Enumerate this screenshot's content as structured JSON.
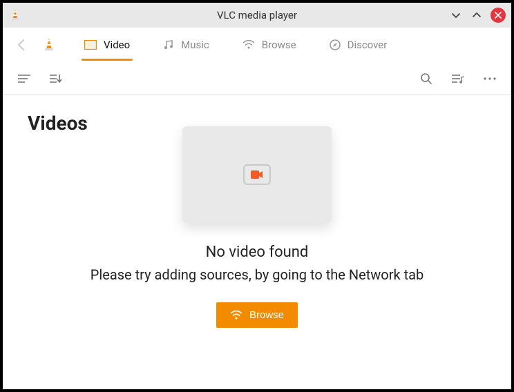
{
  "window": {
    "title": "VLC media player"
  },
  "tabs": {
    "video": "Video",
    "music": "Music",
    "browse": "Browse",
    "discover": "Discover"
  },
  "page": {
    "title": "Videos",
    "empty_heading": "No video found",
    "empty_subtext": "Please try adding sources, by going to the Network tab",
    "browse_button": "Browse"
  },
  "colors": {
    "accent": "#f38b00",
    "close": "#e0383e"
  }
}
